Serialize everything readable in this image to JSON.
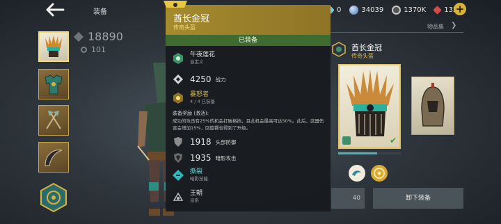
{
  "header": {
    "title": "装备"
  },
  "currencies": [
    {
      "icon": "gem-icon",
      "value": "0",
      "color": "#6fd0e0"
    },
    {
      "icon": "orb-icon",
      "value": "34039",
      "color": "#7fa7d8"
    },
    {
      "icon": "coin-icon",
      "value": "1370K",
      "color": "#c8c8c8"
    },
    {
      "icon": "ruby-icon",
      "value": "1357",
      "color": "#d24a4a"
    }
  ],
  "left": {
    "gear_score": "18890",
    "sub_score": "101",
    "slots": [
      {
        "name": "slot-helmet",
        "selected": true
      },
      {
        "name": "slot-armor",
        "selected": false
      },
      {
        "name": "slot-weapon-axes",
        "selected": false
      },
      {
        "name": "slot-weapon-sickles",
        "selected": false
      }
    ]
  },
  "tooltip": {
    "title": "酋长金冠",
    "rarity": "传奇头盔",
    "equipped": "已装备",
    "style_name": "午夜莲花",
    "style_sub": "自定义",
    "power_value": "4250",
    "power_label": "战力",
    "set_name": "暴怒者",
    "set_progress": "4 / 4 已装备",
    "bonus_title": "装备奖励 (激活):",
    "bonus_text": "成功的攻击有25%的机会打破格挡，且此机会最高可达50%。此后，武器伤害会增加15%，回旋镖也得到了升级。",
    "stat1_value": "1918",
    "stat1_label": "头部防御",
    "stat2_value": "1935",
    "stat2_label": "暗影攻击",
    "perk_name": "撕裂",
    "perk_sub": "暗影技能",
    "dynasty_name": "王朝",
    "dynasty_sub": "派系"
  },
  "right": {
    "tab_label": "物品集",
    "item_name": "酋长金冠",
    "item_rarity": "传奇头盔",
    "ghost_power": "4250",
    "progress": 0.62,
    "left_button": "40",
    "unequip_button": "卸下装备"
  },
  "colors": {
    "legendary_gold": "#d8b64c",
    "equipped_green": "#3f6b31",
    "accent_teal": "#4bb7b8"
  }
}
